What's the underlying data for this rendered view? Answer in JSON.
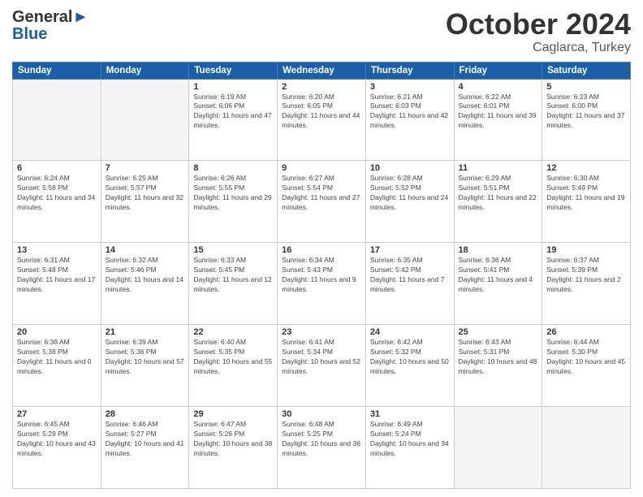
{
  "header": {
    "logo_line1": "General",
    "logo_line2": "Blue",
    "month": "October 2024",
    "location": "Caglarca, Turkey"
  },
  "weekdays": [
    "Sunday",
    "Monday",
    "Tuesday",
    "Wednesday",
    "Thursday",
    "Friday",
    "Saturday"
  ],
  "weeks": [
    [
      {
        "day": "",
        "empty": true
      },
      {
        "day": "",
        "empty": true
      },
      {
        "day": "1",
        "sunrise": "6:19 AM",
        "sunset": "6:06 PM",
        "daylight": "11 hours and 47 minutes."
      },
      {
        "day": "2",
        "sunrise": "6:20 AM",
        "sunset": "6:05 PM",
        "daylight": "11 hours and 44 minutes."
      },
      {
        "day": "3",
        "sunrise": "6:21 AM",
        "sunset": "6:03 PM",
        "daylight": "11 hours and 42 minutes."
      },
      {
        "day": "4",
        "sunrise": "6:22 AM",
        "sunset": "6:01 PM",
        "daylight": "11 hours and 39 minutes."
      },
      {
        "day": "5",
        "sunrise": "6:23 AM",
        "sunset": "6:00 PM",
        "daylight": "11 hours and 37 minutes."
      }
    ],
    [
      {
        "day": "6",
        "sunrise": "6:24 AM",
        "sunset": "5:58 PM",
        "daylight": "11 hours and 34 minutes."
      },
      {
        "day": "7",
        "sunrise": "6:25 AM",
        "sunset": "5:57 PM",
        "daylight": "11 hours and 32 minutes."
      },
      {
        "day": "8",
        "sunrise": "6:26 AM",
        "sunset": "5:55 PM",
        "daylight": "11 hours and 29 minutes."
      },
      {
        "day": "9",
        "sunrise": "6:27 AM",
        "sunset": "5:54 PM",
        "daylight": "11 hours and 27 minutes."
      },
      {
        "day": "10",
        "sunrise": "6:28 AM",
        "sunset": "5:52 PM",
        "daylight": "11 hours and 24 minutes."
      },
      {
        "day": "11",
        "sunrise": "6:29 AM",
        "sunset": "5:51 PM",
        "daylight": "11 hours and 22 minutes."
      },
      {
        "day": "12",
        "sunrise": "6:30 AM",
        "sunset": "5:49 PM",
        "daylight": "11 hours and 19 minutes."
      }
    ],
    [
      {
        "day": "13",
        "sunrise": "6:31 AM",
        "sunset": "5:48 PM",
        "daylight": "11 hours and 17 minutes."
      },
      {
        "day": "14",
        "sunrise": "6:32 AM",
        "sunset": "5:46 PM",
        "daylight": "11 hours and 14 minutes."
      },
      {
        "day": "15",
        "sunrise": "6:33 AM",
        "sunset": "5:45 PM",
        "daylight": "11 hours and 12 minutes."
      },
      {
        "day": "16",
        "sunrise": "6:34 AM",
        "sunset": "5:43 PM",
        "daylight": "11 hours and 9 minutes."
      },
      {
        "day": "17",
        "sunrise": "6:35 AM",
        "sunset": "5:42 PM",
        "daylight": "11 hours and 7 minutes."
      },
      {
        "day": "18",
        "sunrise": "6:36 AM",
        "sunset": "5:41 PM",
        "daylight": "11 hours and 4 minutes."
      },
      {
        "day": "19",
        "sunrise": "6:37 AM",
        "sunset": "5:39 PM",
        "daylight": "11 hours and 2 minutes."
      }
    ],
    [
      {
        "day": "20",
        "sunrise": "6:38 AM",
        "sunset": "5:38 PM",
        "daylight": "11 hours and 0 minutes."
      },
      {
        "day": "21",
        "sunrise": "6:39 AM",
        "sunset": "5:36 PM",
        "daylight": "10 hours and 57 minutes."
      },
      {
        "day": "22",
        "sunrise": "6:40 AM",
        "sunset": "5:35 PM",
        "daylight": "10 hours and 55 minutes."
      },
      {
        "day": "23",
        "sunrise": "6:41 AM",
        "sunset": "5:34 PM",
        "daylight": "10 hours and 52 minutes."
      },
      {
        "day": "24",
        "sunrise": "6:42 AM",
        "sunset": "5:32 PM",
        "daylight": "10 hours and 50 minutes."
      },
      {
        "day": "25",
        "sunrise": "6:43 AM",
        "sunset": "5:31 PM",
        "daylight": "10 hours and 48 minutes."
      },
      {
        "day": "26",
        "sunrise": "6:44 AM",
        "sunset": "5:30 PM",
        "daylight": "10 hours and 45 minutes."
      }
    ],
    [
      {
        "day": "27",
        "sunrise": "6:45 AM",
        "sunset": "5:29 PM",
        "daylight": "10 hours and 43 minutes."
      },
      {
        "day": "28",
        "sunrise": "6:46 AM",
        "sunset": "5:27 PM",
        "daylight": "10 hours and 41 minutes."
      },
      {
        "day": "29",
        "sunrise": "6:47 AM",
        "sunset": "5:26 PM",
        "daylight": "10 hours and 38 minutes."
      },
      {
        "day": "30",
        "sunrise": "6:48 AM",
        "sunset": "5:25 PM",
        "daylight": "10 hours and 36 minutes."
      },
      {
        "day": "31",
        "sunrise": "6:49 AM",
        "sunset": "5:24 PM",
        "daylight": "10 hours and 34 minutes."
      },
      {
        "day": "",
        "empty": true
      },
      {
        "day": "",
        "empty": true
      }
    ]
  ],
  "labels": {
    "sunrise": "Sunrise:",
    "sunset": "Sunset:",
    "daylight": "Daylight:"
  }
}
